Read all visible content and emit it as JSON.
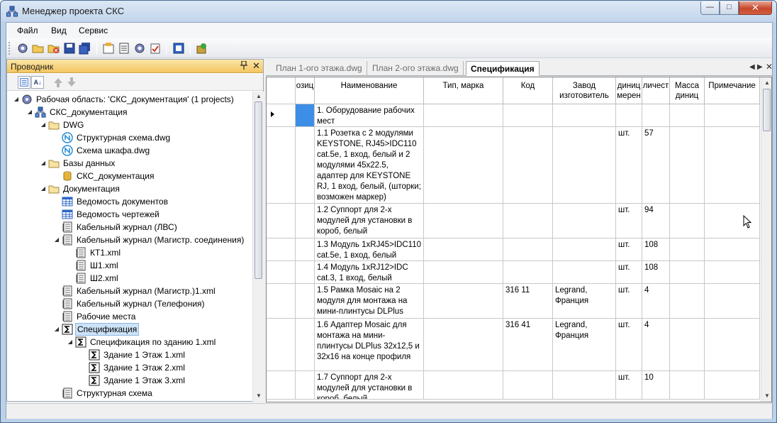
{
  "window": {
    "title": "Менеджер проекта СКС",
    "minimize_label": "—",
    "maximize_label": "□",
    "close_label": "✕"
  },
  "menu": [
    "Файл",
    "Вид",
    "Сервис"
  ],
  "toolbar": {
    "icons": [
      "settings-icon",
      "open-folder-icon",
      "close-project-icon",
      "save-icon",
      "save-all-icon",
      "properties-icon",
      "document-icon",
      "settings-gear-icon",
      "clipboard-icon",
      "layout-icon",
      "add-icon"
    ]
  },
  "explorer": {
    "title": "Проводник",
    "pin_label": "📌",
    "close_label": "✕",
    "sort_label": "A↓",
    "tree": [
      {
        "label": "Рабочая область: 'СКС_документация' (1 projects)",
        "icon": "workspace-icon",
        "level": 0,
        "expanded": true
      },
      {
        "label": "СКС_документация",
        "icon": "project-icon",
        "level": 1,
        "expanded": true
      },
      {
        "label": "DWG",
        "icon": "folder-icon",
        "level": 2,
        "expanded": true
      },
      {
        "label": "Структурная схема.dwg",
        "icon": "nanocad-file-icon",
        "level": 3,
        "expanded": null
      },
      {
        "label": "Схема шкафа.dwg",
        "icon": "nanocad-file-icon",
        "level": 3,
        "expanded": null
      },
      {
        "label": "Базы данных",
        "icon": "folder-icon",
        "level": 2,
        "expanded": true
      },
      {
        "label": "СКС_документация",
        "icon": "database-icon",
        "level": 3,
        "expanded": null
      },
      {
        "label": "Документация",
        "icon": "folder-icon",
        "level": 2,
        "expanded": true
      },
      {
        "label": "Ведомость документов",
        "icon": "table-icon",
        "level": 3,
        "expanded": null
      },
      {
        "label": "Ведомость чертежей",
        "icon": "table-icon",
        "level": 3,
        "expanded": null
      },
      {
        "label": "Кабельный журнал (ЛВС)",
        "icon": "journal-icon",
        "level": 3,
        "expanded": null
      },
      {
        "label": "Кабельный журнал (Магистр. соединения)",
        "icon": "journal-icon",
        "level": 3,
        "expanded": true
      },
      {
        "label": "КТ1.xml",
        "icon": "journal-icon",
        "level": 4,
        "expanded": null
      },
      {
        "label": "Ш1.xml",
        "icon": "journal-icon",
        "level": 4,
        "expanded": null
      },
      {
        "label": "Ш2.xml",
        "icon": "journal-icon",
        "level": 4,
        "expanded": null
      },
      {
        "label": "Кабельный журнал (Магистр.)1.xml",
        "icon": "journal-icon",
        "level": 3,
        "expanded": null
      },
      {
        "label": "Кабельный журнал (Телефония)",
        "icon": "journal-icon",
        "level": 3,
        "expanded": null
      },
      {
        "label": "Рабочие места",
        "icon": "journal-icon",
        "level": 3,
        "expanded": null
      },
      {
        "label": "Спецификация",
        "icon": "sigma-icon",
        "level": 3,
        "expanded": true,
        "selected": true
      },
      {
        "label": "Спецификация по зданию 1.xml",
        "icon": "sigma-icon",
        "level": 4,
        "expanded": true
      },
      {
        "label": "Здание 1 Этаж 1.xml",
        "icon": "sigma-icon",
        "level": 5,
        "expanded": null
      },
      {
        "label": "Здание 1 Этаж 2.xml",
        "icon": "sigma-icon",
        "level": 5,
        "expanded": null
      },
      {
        "label": "Здание 1 Этаж 3.xml",
        "icon": "sigma-icon",
        "level": 5,
        "expanded": null
      },
      {
        "label": "Структурная схема",
        "icon": "journal-icon",
        "level": 3,
        "expanded": null
      }
    ]
  },
  "tabs": [
    {
      "label": "План 1-ого этажа.dwg",
      "active": false
    },
    {
      "label": "План 2-ого этажа.dwg",
      "active": false
    },
    {
      "label": "Спецификация",
      "active": true
    }
  ],
  "tab_nav": {
    "prev": "◀",
    "next": "▶",
    "close": "✕"
  },
  "grid": {
    "columns": [
      "озиц",
      "Наименование",
      "Тип, марка",
      "Код",
      "Завод\nизготовитель",
      "диниц\nмерен",
      "личест",
      "Масса\nдиниц",
      "Примечание"
    ],
    "rows": [
      [
        "",
        "1. Оборудование рабочих мест",
        "",
        "",
        "",
        "",
        "",
        "",
        ""
      ],
      [
        "",
        "1.1 Розетка с 2 модулями KEYSTONE, RJ45>IDC110 cat.5e, 1 вход, белый и 2 модулями 45x22.5, адаптер для KEYSTONE RJ, 1 вход, белый, (шторки; возможен маркер)",
        "",
        "",
        "",
        "шт.",
        "57",
        "",
        ""
      ],
      [
        "",
        "1.2 Суппорт для 2-х модулей для установки в короб, белый",
        "",
        "",
        "",
        "шт.",
        "94",
        "",
        ""
      ],
      [
        "",
        "1.3 Модуль 1xRJ45>IDC110 cat.5e, 1 вход, белый",
        "",
        "",
        "",
        "шт.",
        "108",
        "",
        ""
      ],
      [
        "",
        "1.4 Модуль 1xRJ12>IDC cat.3, 1 вход, белый",
        "",
        "",
        "",
        "шт.",
        "108",
        "",
        ""
      ],
      [
        "",
        "1.5 Рамка Mosaic на 2 модуля для монтажа на мини-плинтусы DLPlus",
        "",
        "316 11",
        "Legrand, Франция",
        "шт.",
        "4",
        "",
        ""
      ],
      [
        "",
        "1.6 Адаптер Mosaic для монтажа на мини-плинтусы DLPlus 32x12,5 и 32x16 на конце профиля",
        "",
        "316 41",
        "Legrand, Франция",
        "шт.",
        "4",
        "",
        ""
      ],
      [
        "",
        "1.7 Суппорт для 2-х модулей для установки в короб, белый",
        "",
        "",
        "",
        "шт.",
        "10",
        "",
        ""
      ]
    ]
  },
  "colors": {
    "explorer_header": "#f4c660",
    "selection": "#cde3f8",
    "current_cell": "#3d8ee6"
  }
}
